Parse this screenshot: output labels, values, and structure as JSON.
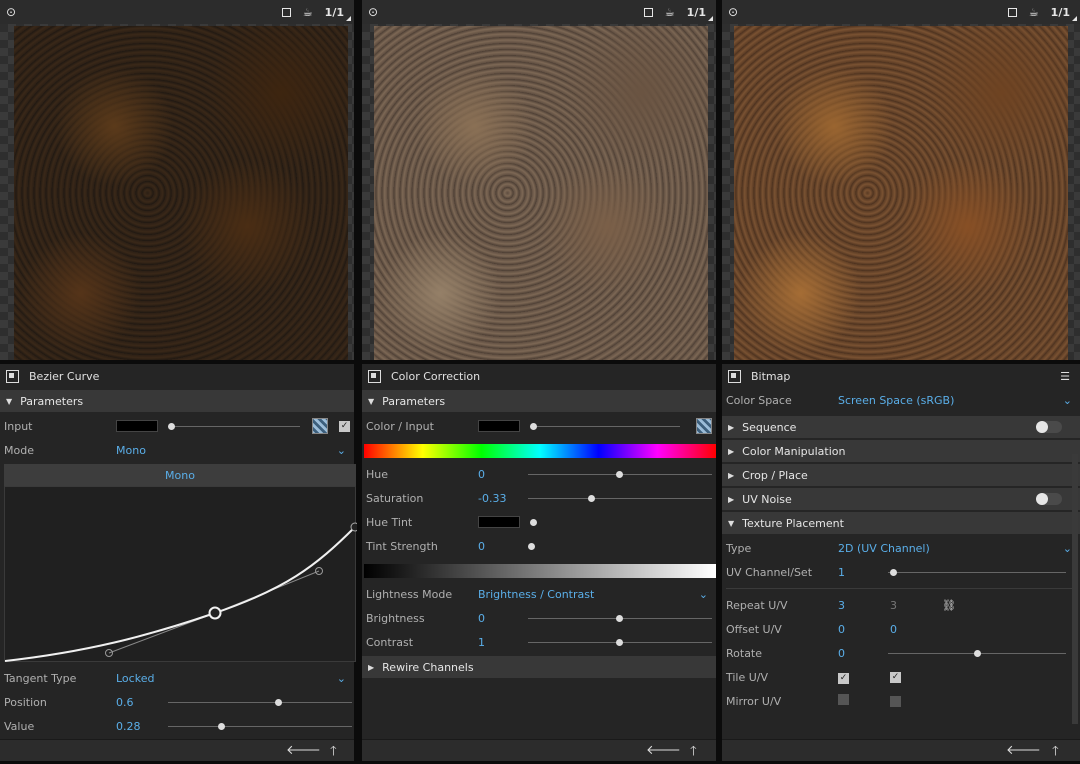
{
  "viewports": [
    {
      "ratio": "1/1"
    },
    {
      "ratio": "1/1"
    },
    {
      "ratio": "1/1"
    }
  ],
  "bezier": {
    "title": "Bezier Curve",
    "section": "Parameters",
    "input_label": "Input",
    "mode_label": "Mode",
    "mode_value": "Mono",
    "curve_header": "Mono",
    "tangent_label": "Tangent Type",
    "tangent_value": "Locked",
    "position_label": "Position",
    "position_value": "0.6",
    "position_level": 0.6,
    "value_label": "Value",
    "value_value": "0.28",
    "value_level": 0.28
  },
  "color_correction": {
    "title": "Color Correction",
    "section": "Parameters",
    "input_label": "Color / Input",
    "hue_label": "Hue",
    "hue_value": "0",
    "saturation_label": "Saturation",
    "saturation_value": "-0.33",
    "hue_tint_label": "Hue Tint",
    "tint_strength_label": "Tint Strength",
    "tint_strength_value": "0",
    "lightness_mode_label": "Lightness Mode",
    "lightness_mode_value": "Brightness / Contrast",
    "brightness_label": "Brightness",
    "brightness_value": "0",
    "contrast_label": "Contrast",
    "contrast_value": "1",
    "rewire_section": "Rewire Channels"
  },
  "bitmap": {
    "title": "Bitmap",
    "color_space_label": "Color Space",
    "color_space_value": "Screen Space (sRGB)",
    "sections": [
      "Sequence",
      "Color Manipulation",
      "Crop / Place",
      "UV Noise",
      "Texture Placement"
    ],
    "type_label": "Type",
    "type_value": "2D (UV Channel)",
    "uv_channel_label": "UV Channel/Set",
    "uv_channel_value": "1",
    "repeat_label": "Repeat U/V",
    "repeat_u": "3",
    "repeat_v": "3",
    "offset_label": "Offset U/V",
    "offset_u": "0",
    "offset_v": "0",
    "rotate_label": "Rotate",
    "rotate_value": "0",
    "tile_label": "Tile U/V",
    "tile_u": true,
    "tile_v": true,
    "mirror_label": "Mirror U/V",
    "mirror_u": false,
    "mirror_v": false
  },
  "colors": {
    "accent": "#5aaee8",
    "panel": "#252525",
    "section": "#383838"
  }
}
